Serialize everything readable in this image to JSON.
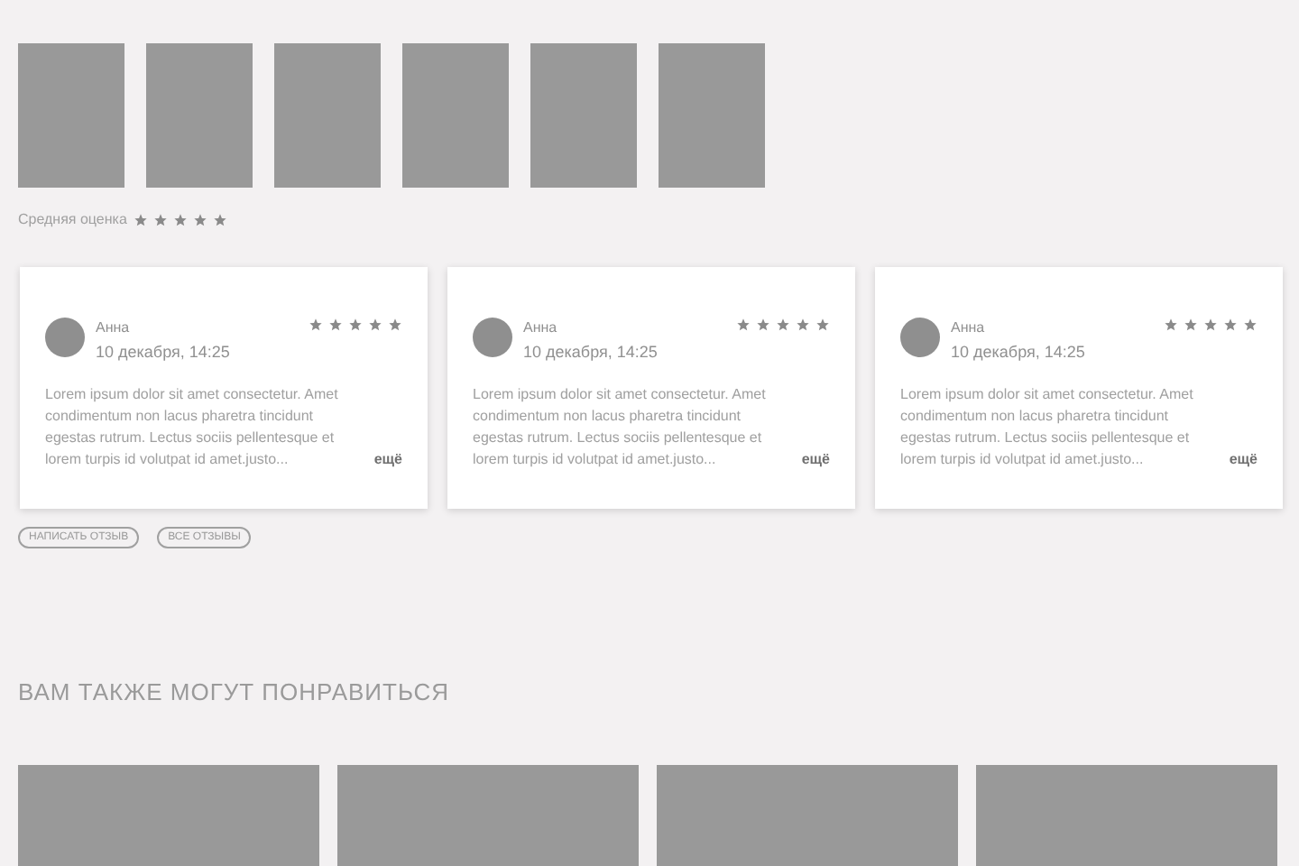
{
  "thumbnails": [
    {
      "kind": "placeholder"
    },
    {
      "kind": "placeholder"
    },
    {
      "kind": "placeholder"
    },
    {
      "kind": "placeholder"
    },
    {
      "kind": "placeholder"
    },
    {
      "kind": "placeholder"
    }
  ],
  "average_rating": {
    "label": "Средняя оценка",
    "stars": 5
  },
  "reviews": [
    {
      "author": "Анна",
      "date": "10 декабря, 14:25",
      "stars": 5,
      "text": "Lorem ipsum dolor sit amet consectetur. Amet condimentum non lacus pharetra tincidunt egestas rutrum. Lectus sociis pellentesque et lorem turpis id volutpat id amet.justo...",
      "more": "ещё"
    },
    {
      "author": "Анна",
      "date": "10 декабря, 14:25",
      "stars": 5,
      "text": "Lorem ipsum dolor sit amet consectetur. Amet condimentum non lacus pharetra tincidunt egestas rutrum. Lectus sociis pellentesque et lorem turpis id volutpat id amet.justo...",
      "more": "ещё"
    },
    {
      "author": "Анна",
      "date": "10 декабря, 14:25",
      "stars": 5,
      "text": "Lorem ipsum dolor sit amet consectetur. Amet condimentum non lacus pharetra tincidunt egestas rutrum. Lectus sociis pellentesque et lorem turpis id volutpat id amet.justo...",
      "more": "ещё"
    }
  ],
  "review_buttons": [
    "НАПИСАТЬ ОТЗЫВ",
    "ВСЕ ОТЗЫВЫ"
  ],
  "recommendations": {
    "title": "ВАМ ТАКЖЕ МОГУТ ПОНРАВИТЬСЯ",
    "items": [
      {
        "kind": "placeholder"
      },
      {
        "kind": "placeholder"
      },
      {
        "kind": "placeholder"
      },
      {
        "kind": "placeholder"
      }
    ]
  }
}
